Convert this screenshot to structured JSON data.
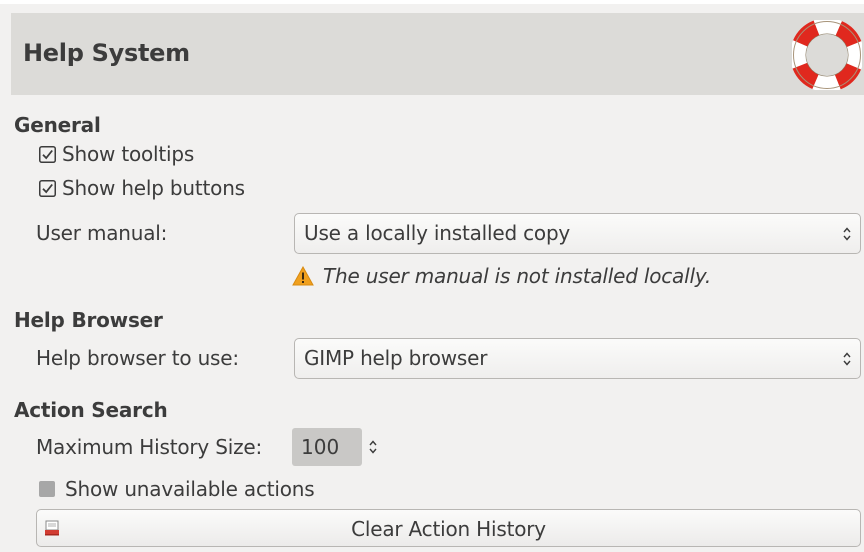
{
  "header": {
    "title": "Help System",
    "icon": "lifebuoy-icon"
  },
  "general": {
    "title": "General",
    "show_tooltips": {
      "label": "Show tooltips",
      "checked": true
    },
    "show_help_buttons": {
      "label": "Show help buttons",
      "checked": true
    },
    "user_manual": {
      "label": "User manual:",
      "value": "Use a locally installed copy"
    },
    "warning": {
      "icon": "warning-icon",
      "text": "The user manual is not installed locally."
    }
  },
  "help_browser": {
    "title": "Help Browser",
    "label": "Help browser to use:",
    "value": "GIMP help browser"
  },
  "action_search": {
    "title": "Action Search",
    "max_history": {
      "label": "Maximum History Size:",
      "value": "100"
    },
    "show_unavailable": {
      "label": "Show unavailable actions",
      "checked": false
    },
    "clear_button": {
      "label": "Clear Action History",
      "icon": "clear-history-icon"
    }
  },
  "colors": {
    "header_bg": "#dcdbd8",
    "window_bg": "#f2f1f0",
    "text": "#3c3c3c",
    "warning": "#f0a01e",
    "lifebuoy_red": "#e0281e"
  }
}
